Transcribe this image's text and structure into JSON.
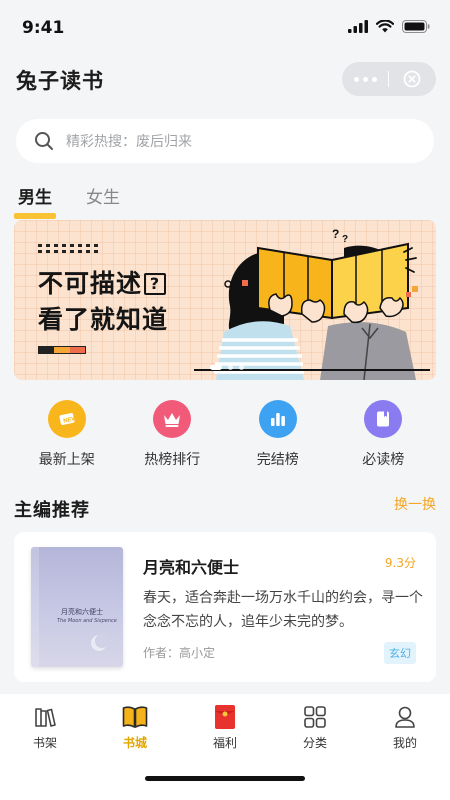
{
  "status_bar": {
    "time": "9:41"
  },
  "header": {
    "title": "兔子读书"
  },
  "search": {
    "placeholder": "精彩热搜：废后归来"
  },
  "gender_tabs": [
    {
      "label": "男生",
      "active": true
    },
    {
      "label": "女生",
      "active": false
    }
  ],
  "banner": {
    "line1": "不可描述",
    "question_mark": "?",
    "line2": "看了就知道"
  },
  "quick_nav": [
    {
      "label": "最新上架",
      "icon": "new-arrival-icon",
      "color": "#f8b51c"
    },
    {
      "label": "热榜排行",
      "icon": "crown-icon",
      "color": "#f25a7a"
    },
    {
      "label": "完结榜",
      "icon": "chart-icon",
      "color": "#3ea2f2"
    },
    {
      "label": "必读榜",
      "icon": "bookmark-icon",
      "color": "#8a7cf0"
    }
  ],
  "recommend": {
    "title": "主编推荐",
    "action": "换一换",
    "book": {
      "title": "月亮和六便士",
      "score": "9.3分",
      "description": "春天，适合奔赴一场万水千山的约会，寻一个念念不忘的人，追年少未完的梦。",
      "author": "作者：高小定",
      "tag": "玄幻",
      "cover_title": "月亮和六便士",
      "cover_subtitle": "The Moon and Sixpence"
    }
  },
  "tab_bar": [
    {
      "label": "书架",
      "icon": "bookshelf-icon",
      "active": false
    },
    {
      "label": "书城",
      "icon": "open-book-icon",
      "active": true
    },
    {
      "label": "福利",
      "icon": "red-envelope-icon",
      "active": false
    },
    {
      "label": "分类",
      "icon": "grid-icon",
      "active": false
    },
    {
      "label": "我的",
      "icon": "user-icon",
      "active": false
    }
  ],
  "colors": {
    "accent": "#f5a623",
    "tab_active": "#e3a600",
    "banner_bg": "#fbe3cf"
  }
}
